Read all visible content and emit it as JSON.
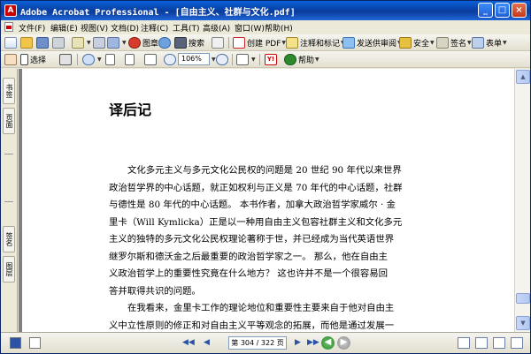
{
  "window": {
    "title": "Adobe Acrobat Professional - [自由主义、社群与文化.pdf]",
    "app_icon_glyph": "A",
    "min_glyph": "_",
    "max_glyph": "□",
    "close_glyph": "×",
    "colors": {
      "titlebar": "#0a4fc4",
      "chrome": "#ece9d8",
      "doc_bg": "#808080"
    }
  },
  "menu": [
    "文件(F)",
    "编辑(E)",
    "视图(V)",
    "文档(D)",
    "注释(C)",
    "工具(T)",
    "高级(A)",
    "窗口(W)",
    "帮助(H)"
  ],
  "toolbar1": {
    "create_pdf": "创建 PDF",
    "comment_markup": "注释和标记",
    "send_review": "发送供审阅",
    "security": "安全",
    "sign": "签名",
    "forms": "表单",
    "image_label": "图章",
    "search_label": "搜索"
  },
  "toolbar2": {
    "select_label": "选择",
    "zoom_value": "106%",
    "help_label": "帮助"
  },
  "left_tabs": [
    "书签",
    "页面",
    "签名",
    "图层"
  ],
  "document": {
    "heading": "译后记",
    "para1_lines": [
      "文化多元主义与多元文化公民权的问题是 20 世纪 90 年代以来世界",
      "政治哲学界的中心话题，就正如权利与正义是 70 年代的中心话题，社群",
      "与德性是 80 年代的中心话题。 本书作者，加拿大政治哲学家威尔 · 金",
      "里卡（Will Kymlicka）正是以一种用自由主义包容社群主义和文化多元",
      "主义的独特的多元文化公民权理论著称于世，并已经成为当代英语世界",
      "继罗尔斯和德沃金之后最重要的政治哲学家之一。 那么，他在自由主",
      "义政治哲学上的重要性究竟在什么地方？ 这也许并不是一个很容易回",
      "答并取得共识的问题。"
    ],
    "para2_lines": [
      "在我看来，金里卡工作的理论地位和重要性主要来自于他对自由主",
      "义中立性原则的修正和对自由主义平等观念的拓展，而他是通过发展一"
    ]
  },
  "status": {
    "page_display": "第 304 / 322 页",
    "page_progress": 0.944
  },
  "icons": {
    "first": "◀◀",
    "prev": "◀",
    "next": "▶",
    "last": "▶▶",
    "go_back": "◀",
    "go_forward": "▶",
    "scroll_up": "▲",
    "scroll_down": "▼",
    "dropdown": "▼"
  }
}
